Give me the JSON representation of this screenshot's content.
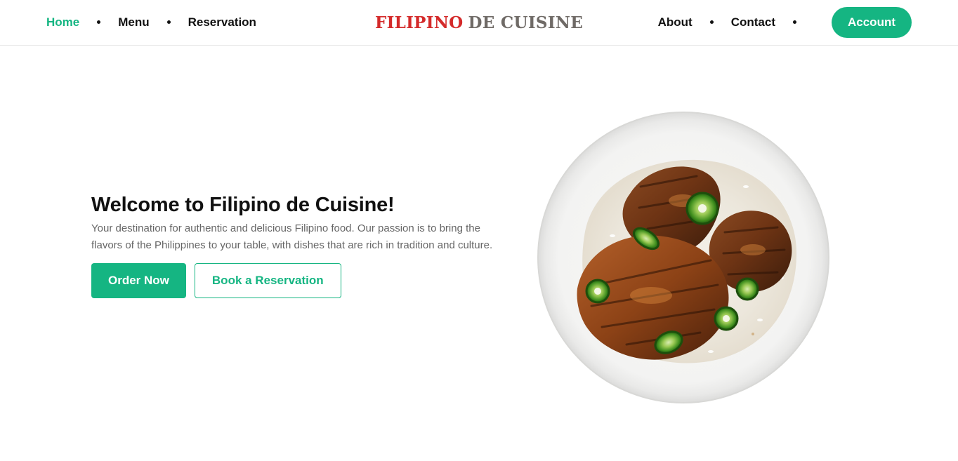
{
  "nav": {
    "left_links": [
      "Home",
      "Menu",
      "Reservation"
    ],
    "active": "Home",
    "right_links": [
      "About",
      "Contact"
    ],
    "account_label": "Account"
  },
  "brand": {
    "part1": "FILIPINO",
    "part2": "DE CUISINE"
  },
  "hero": {
    "title": "Welcome to Filipino de Cuisine!",
    "description": "Your destination for authentic and delicious Filipino food. Our passion is to bring the flavors of the Philippines to your table, with dishes that are rich in tradition and culture.",
    "primary_button": "Order Now",
    "secondary_button": "Book a Reservation"
  },
  "colors": {
    "accent": "#15b582",
    "brand_red": "#d42a2a",
    "brand_gray": "#6f6a66"
  },
  "image": {
    "icon": "grilled-chicken-rice-plate-image"
  }
}
